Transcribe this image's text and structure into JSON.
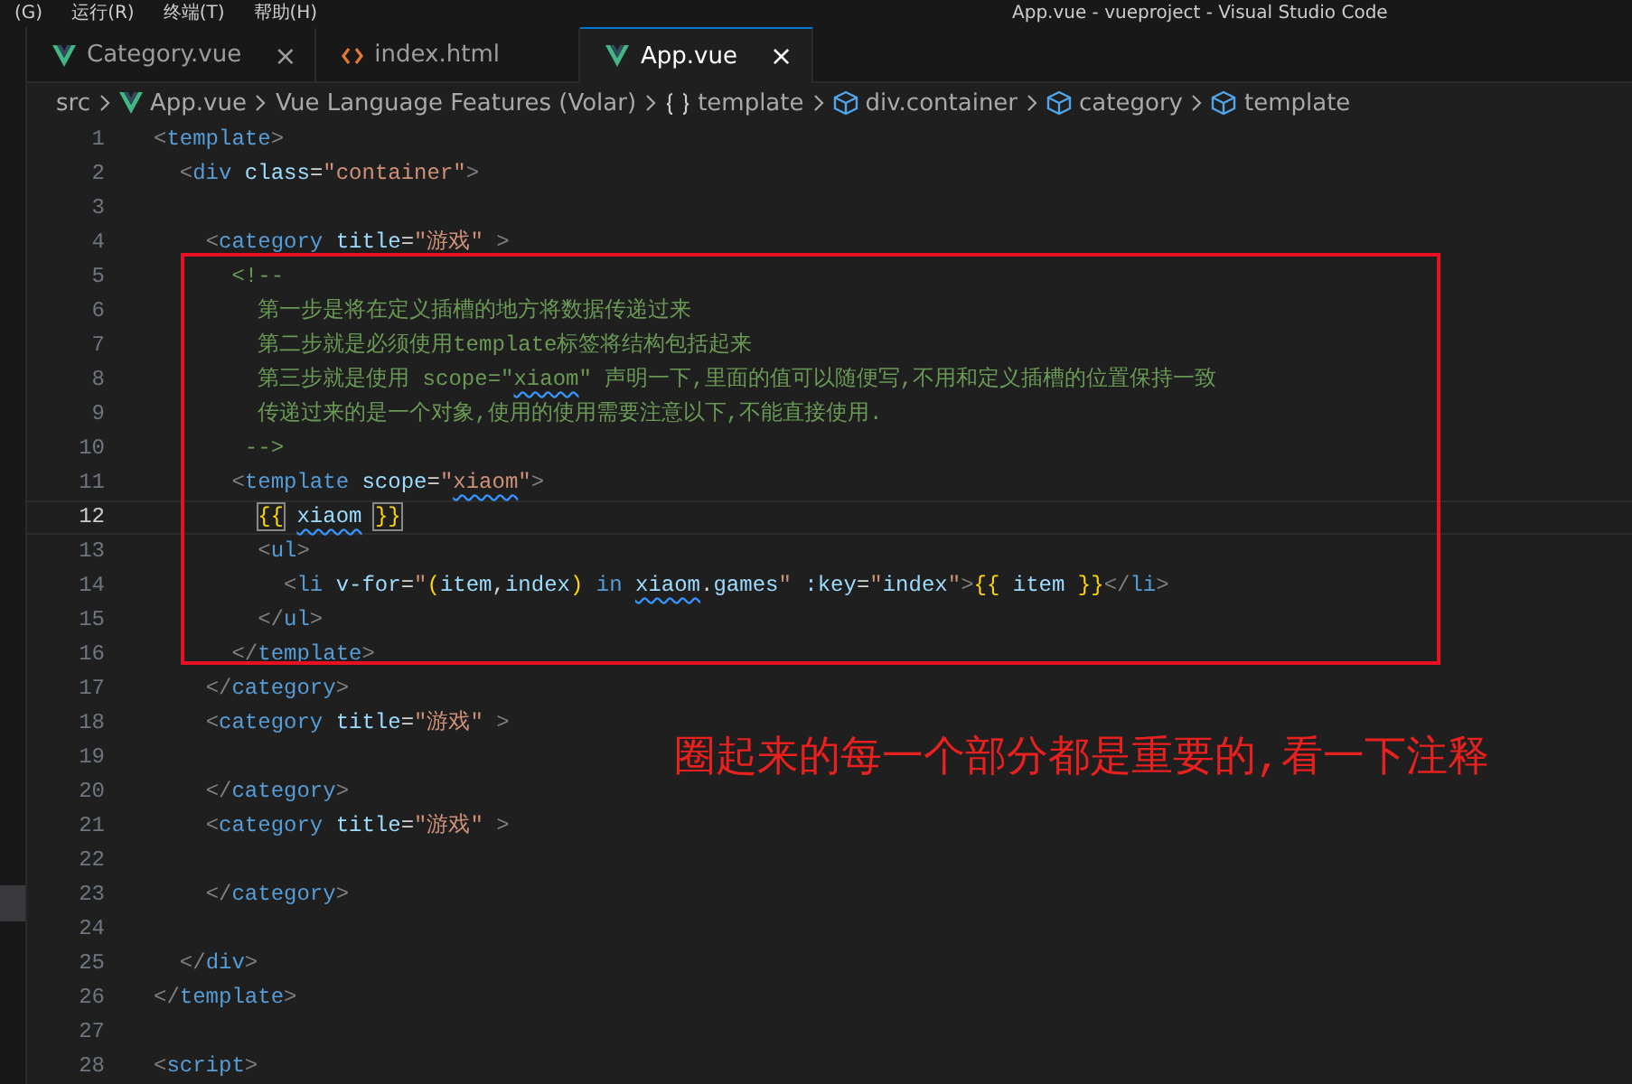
{
  "menu_bar": {
    "items": [
      "(G)",
      "运行(R)",
      "终端(T)",
      "帮助(H)"
    ],
    "window_title": "App.vue - vueproject - Visual Studio Code"
  },
  "tabs": [
    {
      "label": "Category.vue",
      "selected": false,
      "close": "×"
    },
    {
      "label": "index.html",
      "selected": false
    },
    {
      "label": "App.vue",
      "selected": true,
      "close": "×"
    }
  ],
  "breadcrumb": [
    {
      "label": "src"
    },
    {
      "label": "App.vue"
    },
    {
      "label": "Vue Language Features (Volar)"
    },
    {
      "label": "template"
    },
    {
      "label": "div.container"
    },
    {
      "label": "category"
    },
    {
      "label": "template"
    }
  ],
  "editor": {
    "lines": [
      {
        "number": "1",
        "active": false,
        "tokens": [
          {
            "kind": "punct",
            "text": "<"
          },
          {
            "kind": "tag",
            "text": "template"
          },
          {
            "kind": "punct",
            "text": ">"
          }
        ]
      },
      {
        "number": "2",
        "active": false,
        "tokens": [
          {
            "kind": "punct",
            "text": "  <"
          },
          {
            "kind": "tag",
            "text": "div"
          },
          {
            "kind": "attr",
            "text": " class"
          },
          {
            "kind": "plain",
            "text": "="
          },
          {
            "kind": "string",
            "text": "\"container\""
          },
          {
            "kind": "punct",
            "text": ">"
          }
        ]
      },
      {
        "number": "3",
        "active": false
      },
      {
        "number": "4",
        "active": false,
        "tokens": [
          {
            "kind": "punct",
            "text": "    <"
          },
          {
            "kind": "tag",
            "text": "category"
          },
          {
            "kind": "attr",
            "text": " title"
          },
          {
            "kind": "plain",
            "text": "="
          },
          {
            "kind": "string",
            "text": "\"游戏\""
          },
          {
            "kind": "punct",
            "text": " >"
          }
        ]
      },
      {
        "number": "5",
        "active": false,
        "tokens": [
          {
            "kind": "comment",
            "text": "      <!--"
          }
        ]
      },
      {
        "number": "6",
        "active": false,
        "tokens": [
          {
            "kind": "comment",
            "text": "        第一步是将在定义插槽的地方将数据传递过来"
          }
        ]
      },
      {
        "number": "7",
        "active": false,
        "tokens": [
          {
            "kind": "comment",
            "text": "        第二步就是必须使用template标签将结构包括起来"
          }
        ]
      },
      {
        "number": "8",
        "active": false,
        "tokens": [
          {
            "kind": "comment",
            "text": "        第三步就是使用 scope=\""
          },
          {
            "kind": "comment_warn",
            "text": "xiaom"
          },
          {
            "kind": "comment",
            "text": "\" 声明一下,里面的值可以随便写,不用和定义插槽的位置保持一致"
          }
        ]
      },
      {
        "number": "9",
        "active": false,
        "tokens": [
          {
            "kind": "comment",
            "text": "        传递过来的是一个对象,使用的使用需要注意以下,不能直接使用."
          }
        ]
      },
      {
        "number": "10",
        "active": false,
        "tokens": [
          {
            "kind": "comment",
            "text": "       -->"
          }
        ]
      },
      {
        "number": "11",
        "active": false,
        "tokens": [
          {
            "kind": "punct",
            "text": "      <"
          },
          {
            "kind": "tag",
            "text": "template"
          },
          {
            "kind": "attr",
            "text": " scope"
          },
          {
            "kind": "plain",
            "text": "="
          },
          {
            "kind": "string",
            "text": "\""
          },
          {
            "kind": "string_warn",
            "text": "xiaom"
          },
          {
            "kind": "string",
            "text": "\""
          },
          {
            "kind": "punct",
            "text": ">"
          }
        ]
      },
      {
        "number": "12",
        "active": true,
        "tokens": [
          {
            "kind": "brace_match",
            "text": "        {{"
          },
          {
            "kind": "var_warn",
            "text": " xiaom"
          },
          {
            "kind": "brace_match",
            "text": " }}"
          }
        ]
      },
      {
        "number": "13",
        "active": false,
        "tokens": [
          {
            "kind": "punct",
            "text": "        <"
          },
          {
            "kind": "tag",
            "text": "ul"
          },
          {
            "kind": "punct",
            "text": ">"
          }
        ]
      },
      {
        "number": "14",
        "active": false,
        "tokens": [
          {
            "kind": "punct",
            "text": "          <"
          },
          {
            "kind": "tag",
            "text": "li"
          },
          {
            "kind": "attr",
            "text": " v-for"
          },
          {
            "kind": "plain",
            "text": "="
          },
          {
            "kind": "string",
            "text": "\""
          },
          {
            "kind": "brace",
            "text": "("
          },
          {
            "kind": "var",
            "text": "item"
          },
          {
            "kind": "plain",
            "text": ","
          },
          {
            "kind": "var",
            "text": "index"
          },
          {
            "kind": "brace",
            "text": ")"
          },
          {
            "kind": "keyword",
            "text": " in"
          },
          {
            "kind": "var_warn",
            "text": " xiaom"
          },
          {
            "kind": "plain",
            "text": "."
          },
          {
            "kind": "var",
            "text": "games"
          },
          {
            "kind": "string",
            "text": "\""
          },
          {
            "kind": "attr",
            "text": " :key"
          },
          {
            "kind": "plain",
            "text": "="
          },
          {
            "kind": "string",
            "text": "\""
          },
          {
            "kind": "var",
            "text": "index"
          },
          {
            "kind": "string",
            "text": "\""
          },
          {
            "kind": "punct",
            "text": ">"
          },
          {
            "kind": "brace",
            "text": "{{"
          },
          {
            "kind": "var",
            "text": " item"
          },
          {
            "kind": "brace",
            "text": " }}"
          },
          {
            "kind": "punct",
            "text": "</"
          },
          {
            "kind": "tag",
            "text": "li"
          },
          {
            "kind": "punct",
            "text": ">"
          }
        ]
      },
      {
        "number": "15",
        "active": false,
        "tokens": [
          {
            "kind": "punct",
            "text": "        </"
          },
          {
            "kind": "tag",
            "text": "ul"
          },
          {
            "kind": "punct",
            "text": ">"
          }
        ]
      },
      {
        "number": "16",
        "active": false,
        "tokens": [
          {
            "kind": "punct",
            "text": "      </"
          },
          {
            "kind": "tag",
            "text": "template"
          },
          {
            "kind": "punct",
            "text": ">"
          }
        ]
      },
      {
        "number": "17",
        "active": false,
        "tokens": [
          {
            "kind": "punct",
            "text": "    </"
          },
          {
            "kind": "tag",
            "text": "category"
          },
          {
            "kind": "punct",
            "text": ">"
          }
        ]
      },
      {
        "number": "18",
        "active": false,
        "tokens": [
          {
            "kind": "punct",
            "text": "    <"
          },
          {
            "kind": "tag",
            "text": "category"
          },
          {
            "kind": "attr",
            "text": " title"
          },
          {
            "kind": "plain",
            "text": "="
          },
          {
            "kind": "string",
            "text": "\"游戏\""
          },
          {
            "kind": "punct",
            "text": " >"
          }
        ]
      },
      {
        "number": "19",
        "active": false
      },
      {
        "number": "20",
        "active": false,
        "tokens": [
          {
            "kind": "punct",
            "text": "    </"
          },
          {
            "kind": "tag",
            "text": "category"
          },
          {
            "kind": "punct",
            "text": ">"
          }
        ]
      },
      {
        "number": "21",
        "active": false,
        "tokens": [
          {
            "kind": "punct",
            "text": "    <"
          },
          {
            "kind": "tag",
            "text": "category"
          },
          {
            "kind": "attr",
            "text": " title"
          },
          {
            "kind": "plain",
            "text": "="
          },
          {
            "kind": "string",
            "text": "\"游戏\""
          },
          {
            "kind": "punct",
            "text": " >"
          }
        ]
      },
      {
        "number": "22",
        "active": false
      },
      {
        "number": "23",
        "active": false,
        "tokens": [
          {
            "kind": "punct",
            "text": "    </"
          },
          {
            "kind": "tag",
            "text": "category"
          },
          {
            "kind": "punct",
            "text": ">"
          }
        ]
      },
      {
        "number": "24",
        "active": false
      },
      {
        "number": "25",
        "active": false,
        "tokens": [
          {
            "kind": "punct",
            "text": "  </"
          },
          {
            "kind": "tag",
            "text": "div"
          },
          {
            "kind": "punct",
            "text": ">"
          }
        ]
      },
      {
        "number": "26",
        "active": false,
        "tokens": [
          {
            "kind": "punct",
            "text": "</"
          },
          {
            "kind": "tag",
            "text": "template"
          },
          {
            "kind": "punct",
            "text": ">"
          }
        ]
      },
      {
        "number": "27",
        "active": false
      },
      {
        "number": "28",
        "active": false,
        "tokens": [
          {
            "kind": "punct",
            "text": "<"
          },
          {
            "kind": "tag",
            "text": "script"
          },
          {
            "kind": "punct",
            "text": ">"
          }
        ]
      }
    ]
  },
  "annotation": {
    "text": "圈起来的每一个部分都是重要的,看一下注释"
  }
}
